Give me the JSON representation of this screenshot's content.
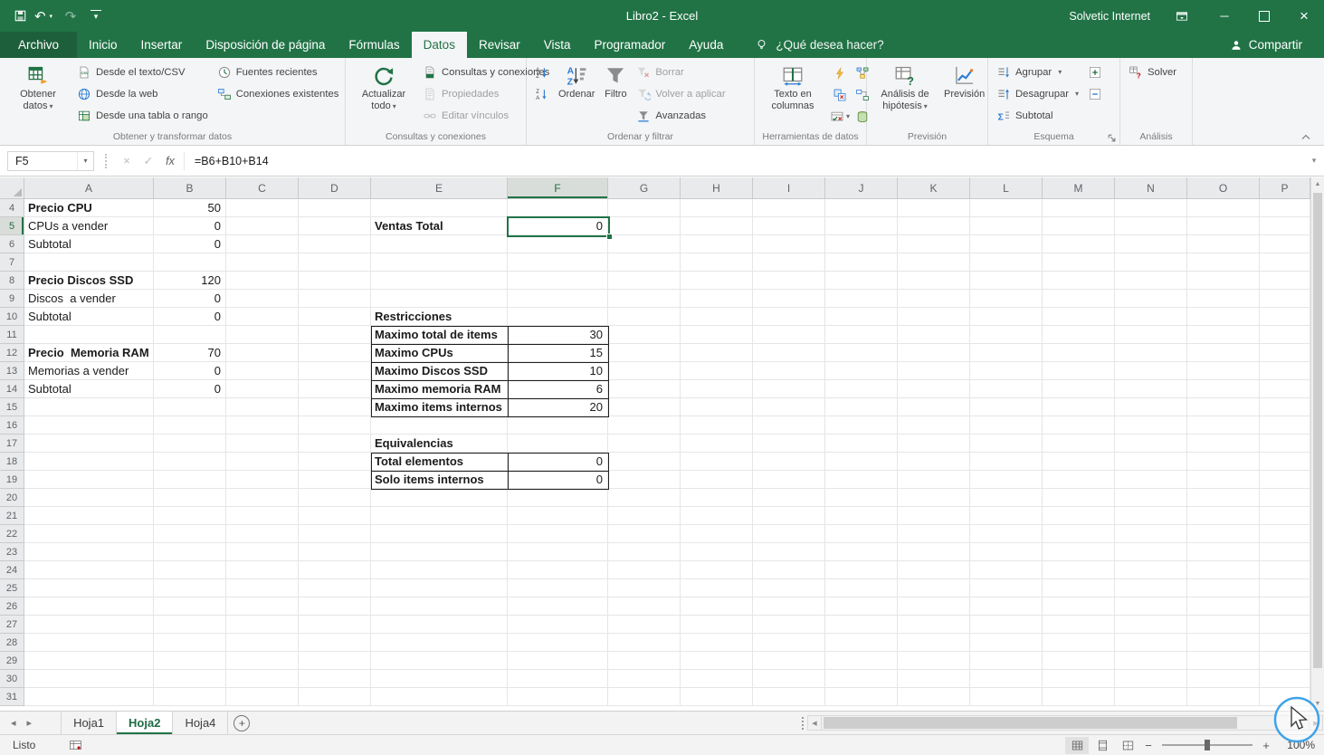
{
  "titlebar": {
    "title": "Libro2 - Excel",
    "account": "Solvetic Internet"
  },
  "tabs": {
    "file_label": "Archivo",
    "items": [
      {
        "label": "Inicio"
      },
      {
        "label": "Insertar"
      },
      {
        "label": "Disposición de página"
      },
      {
        "label": "Fórmulas"
      },
      {
        "label": "Datos",
        "active": true
      },
      {
        "label": "Revisar"
      },
      {
        "label": "Vista"
      },
      {
        "label": "Programador"
      },
      {
        "label": "Ayuda"
      }
    ],
    "search_hint": "¿Qué desea hacer?",
    "share_label": "Compartir"
  },
  "ribbon": {
    "groups": [
      {
        "label": "Obtener y transformar datos",
        "columns": [
          {
            "type": "big",
            "items": [
              {
                "label": "Obtener datos",
                "icon": "get-data-icon",
                "dropdown": true
              }
            ]
          },
          {
            "type": "stack",
            "items": [
              {
                "label": "Desde el texto/CSV",
                "icon": "from-text-csv-icon"
              },
              {
                "label": "Desde la web",
                "icon": "from-web-icon"
              },
              {
                "label": "Desde una tabla o rango",
                "icon": "from-table-range-icon"
              }
            ]
          },
          {
            "type": "stack",
            "items": [
              {
                "label": "Fuentes recientes",
                "icon": "recent-sources-icon"
              },
              {
                "label": "Conexiones existentes",
                "icon": "existing-connections-icon"
              }
            ]
          }
        ]
      },
      {
        "label": "Consultas y conexiones",
        "columns": [
          {
            "type": "big",
            "items": [
              {
                "label": "Actualizar todo",
                "icon": "refresh-all-icon",
                "dropdown": true
              }
            ]
          },
          {
            "type": "stack",
            "items": [
              {
                "label": "Consultas y conexiones",
                "icon": "queries-connections-icon"
              },
              {
                "label": "Propiedades",
                "icon": "properties-icon",
                "disabled": true
              },
              {
                "label": "Editar vínculos",
                "icon": "edit-links-icon",
                "disabled": true
              }
            ]
          }
        ]
      },
      {
        "label": "Ordenar y filtrar",
        "columns": [
          {
            "type": "stack",
            "items": [
              {
                "label": "",
                "icon": "sort-az-icon"
              },
              {
                "label": "",
                "icon": "sort-za-icon"
              }
            ]
          },
          {
            "type": "big",
            "items": [
              {
                "label": "Ordenar",
                "icon": "sort-dialog-icon"
              }
            ]
          },
          {
            "type": "big",
            "items": [
              {
                "label": "Filtro",
                "icon": "filter-icon"
              }
            ]
          },
          {
            "type": "stack",
            "items": [
              {
                "label": "Borrar",
                "icon": "clear-filter-icon",
                "disabled": true
              },
              {
                "label": "Volver a aplicar",
                "icon": "reapply-filter-icon",
                "disabled": true
              },
              {
                "label": "Avanzadas",
                "icon": "advanced-filter-icon"
              }
            ]
          }
        ]
      },
      {
        "label": "Herramientas de datos",
        "columns": [
          {
            "type": "big",
            "items": [
              {
                "label": "Texto en columnas",
                "icon": "text-to-columns-icon"
              }
            ]
          },
          {
            "type": "icongrid",
            "items": [
              {
                "icon": "flash-fill-icon"
              },
              {
                "icon": "consolidate-icon"
              },
              {
                "icon": "remove-duplicates-icon"
              },
              {
                "icon": "relationships-icon"
              },
              {
                "icon": "data-validation-icon",
                "dropdown": true
              },
              {
                "icon": "data-model-icon"
              }
            ]
          }
        ]
      },
      {
        "label": "Previsión",
        "columns": [
          {
            "type": "big",
            "items": [
              {
                "label": "Análisis de hipótesis",
                "icon": "what-if-icon",
                "dropdown": true
              }
            ]
          },
          {
            "type": "big",
            "items": [
              {
                "label": "Previsión",
                "icon": "forecast-icon"
              }
            ]
          }
        ]
      },
      {
        "label": "Esquema",
        "launcher": true,
        "columns": [
          {
            "type": "stack",
            "items": [
              {
                "label": "Agrupar",
                "icon": "group-icon",
                "dropdown": true
              },
              {
                "label": "Desagrupar",
                "icon": "ungroup-icon",
                "dropdown": true
              },
              {
                "label": "Subtotal",
                "icon": "subtotal-icon"
              }
            ]
          },
          {
            "type": "stack",
            "items": [
              {
                "label": "",
                "icon": "show-detail-icon"
              },
              {
                "label": "",
                "icon": "hide-detail-icon"
              }
            ]
          }
        ]
      },
      {
        "label": "Análisis",
        "columns": [
          {
            "type": "stack",
            "items": [
              {
                "label": "Solver",
                "icon": "solver-icon"
              }
            ]
          }
        ]
      }
    ]
  },
  "formula_bar": {
    "name_box": "F5",
    "formula": "=B6+B10+B14",
    "fx_label": "fx"
  },
  "grid": {
    "selected_cell": "F5",
    "columns": [
      "A",
      "B",
      "C",
      "D",
      "E",
      "F",
      "G",
      "H",
      "I",
      "J",
      "K",
      "L",
      "M",
      "N",
      "O",
      "P"
    ],
    "first_row": 4,
    "visible_rows": 28,
    "bordered_ranges": [
      "F5",
      "E11:F15",
      "E18:F19"
    ],
    "cells": [
      {
        "col": "A",
        "row": 4,
        "text": "Precio CPU",
        "bold": true
      },
      {
        "col": "B",
        "row": 4,
        "text": "50",
        "num": true
      },
      {
        "col": "A",
        "row": 5,
        "text": "CPUs a vender"
      },
      {
        "col": "B",
        "row": 5,
        "text": "0",
        "num": true
      },
      {
        "col": "E",
        "row": 5,
        "text": "Ventas Total",
        "bold": true
      },
      {
        "col": "F",
        "row": 5,
        "text": "0",
        "num": true
      },
      {
        "col": "A",
        "row": 6,
        "text": "Subtotal"
      },
      {
        "col": "B",
        "row": 6,
        "text": "0",
        "num": true
      },
      {
        "col": "A",
        "row": 8,
        "text": "Precio Discos SSD",
        "bold": true
      },
      {
        "col": "B",
        "row": 8,
        "text": "120",
        "num": true
      },
      {
        "col": "A",
        "row": 9,
        "text": "Discos  a vender"
      },
      {
        "col": "B",
        "row": 9,
        "text": "0",
        "num": true
      },
      {
        "col": "A",
        "row": 10,
        "text": "Subtotal"
      },
      {
        "col": "B",
        "row": 10,
        "text": "0",
        "num": true
      },
      {
        "col": "E",
        "row": 10,
        "text": "Restricciones",
        "bold": true
      },
      {
        "col": "E",
        "row": 11,
        "text": "Maximo total de items",
        "bold": true
      },
      {
        "col": "F",
        "row": 11,
        "text": "30",
        "num": true
      },
      {
        "col": "A",
        "row": 12,
        "text": "Precio  Memoria RAM",
        "bold": true
      },
      {
        "col": "B",
        "row": 12,
        "text": "70",
        "num": true
      },
      {
        "col": "E",
        "row": 12,
        "text": "Maximo CPUs",
        "bold": true
      },
      {
        "col": "F",
        "row": 12,
        "text": "15",
        "num": true
      },
      {
        "col": "A",
        "row": 13,
        "text": "Memorias a vender"
      },
      {
        "col": "B",
        "row": 13,
        "text": "0",
        "num": true
      },
      {
        "col": "E",
        "row": 13,
        "text": "Maximo Discos SSD",
        "bold": true
      },
      {
        "col": "F",
        "row": 13,
        "text": "10",
        "num": true
      },
      {
        "col": "A",
        "row": 14,
        "text": "Subtotal"
      },
      {
        "col": "B",
        "row": 14,
        "text": "0",
        "num": true
      },
      {
        "col": "E",
        "row": 14,
        "text": "Maximo memoria RAM",
        "bold": true
      },
      {
        "col": "F",
        "row": 14,
        "text": "6",
        "num": true
      },
      {
        "col": "E",
        "row": 15,
        "text": "Maximo items internos",
        "bold": true
      },
      {
        "col": "F",
        "row": 15,
        "text": "20",
        "num": true
      },
      {
        "col": "E",
        "row": 17,
        "text": "Equivalencias",
        "bold": true
      },
      {
        "col": "E",
        "row": 18,
        "text": "Total elementos",
        "bold": true
      },
      {
        "col": "F",
        "row": 18,
        "text": "0",
        "num": true
      },
      {
        "col": "E",
        "row": 19,
        "text": "Solo items internos",
        "bold": true
      },
      {
        "col": "F",
        "row": 19,
        "text": "0",
        "num": true
      }
    ]
  },
  "sheet_tabs": {
    "tabs": [
      {
        "label": "Hoja1"
      },
      {
        "label": "Hoja2",
        "active": true
      },
      {
        "label": "Hoja4"
      }
    ]
  },
  "status_bar": {
    "mode": "Listo",
    "zoom_level": "100%"
  },
  "colors": {
    "accent_green": "#217346"
  }
}
